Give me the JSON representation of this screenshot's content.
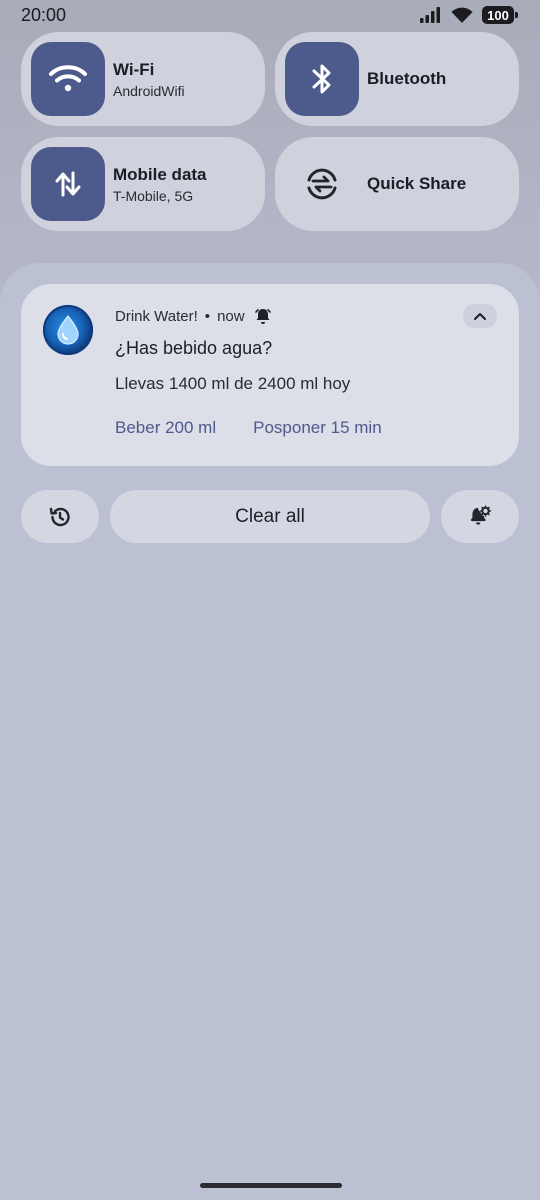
{
  "status_bar": {
    "time": "20:00",
    "battery": "100",
    "icons": [
      "signal-icon",
      "wifi-icon",
      "battery-icon"
    ]
  },
  "quick_tiles": [
    {
      "title": "Wi-Fi",
      "subtitle": "AndroidWifi",
      "icon": "wifi-icon",
      "active": true
    },
    {
      "title": "Bluetooth",
      "subtitle": "",
      "icon": "bluetooth-icon",
      "active": true
    },
    {
      "title": "Mobile data",
      "subtitle": "T-Mobile, 5G",
      "icon": "mobile-data-icon",
      "active": true
    },
    {
      "title": "Quick Share",
      "subtitle": "",
      "icon": "quick-share-icon",
      "active": false
    }
  ],
  "notification": {
    "app_name": "Drink Water!",
    "separator": "•",
    "time": "now",
    "title": "¿Has bebido agua?",
    "body": "Llevas 1400 ml de 2400 ml hoy",
    "actions": [
      "Beber 200 ml",
      "Posponer 15 min"
    ]
  },
  "bottom_controls": {
    "history_icon": "history-icon",
    "clear_all": "Clear all",
    "settings_icon": "notification-settings-icon"
  },
  "colors": {
    "accent": "#4d5a8c",
    "tile_bg": "#cfd1dc",
    "card_bg": "#dcdee8"
  }
}
